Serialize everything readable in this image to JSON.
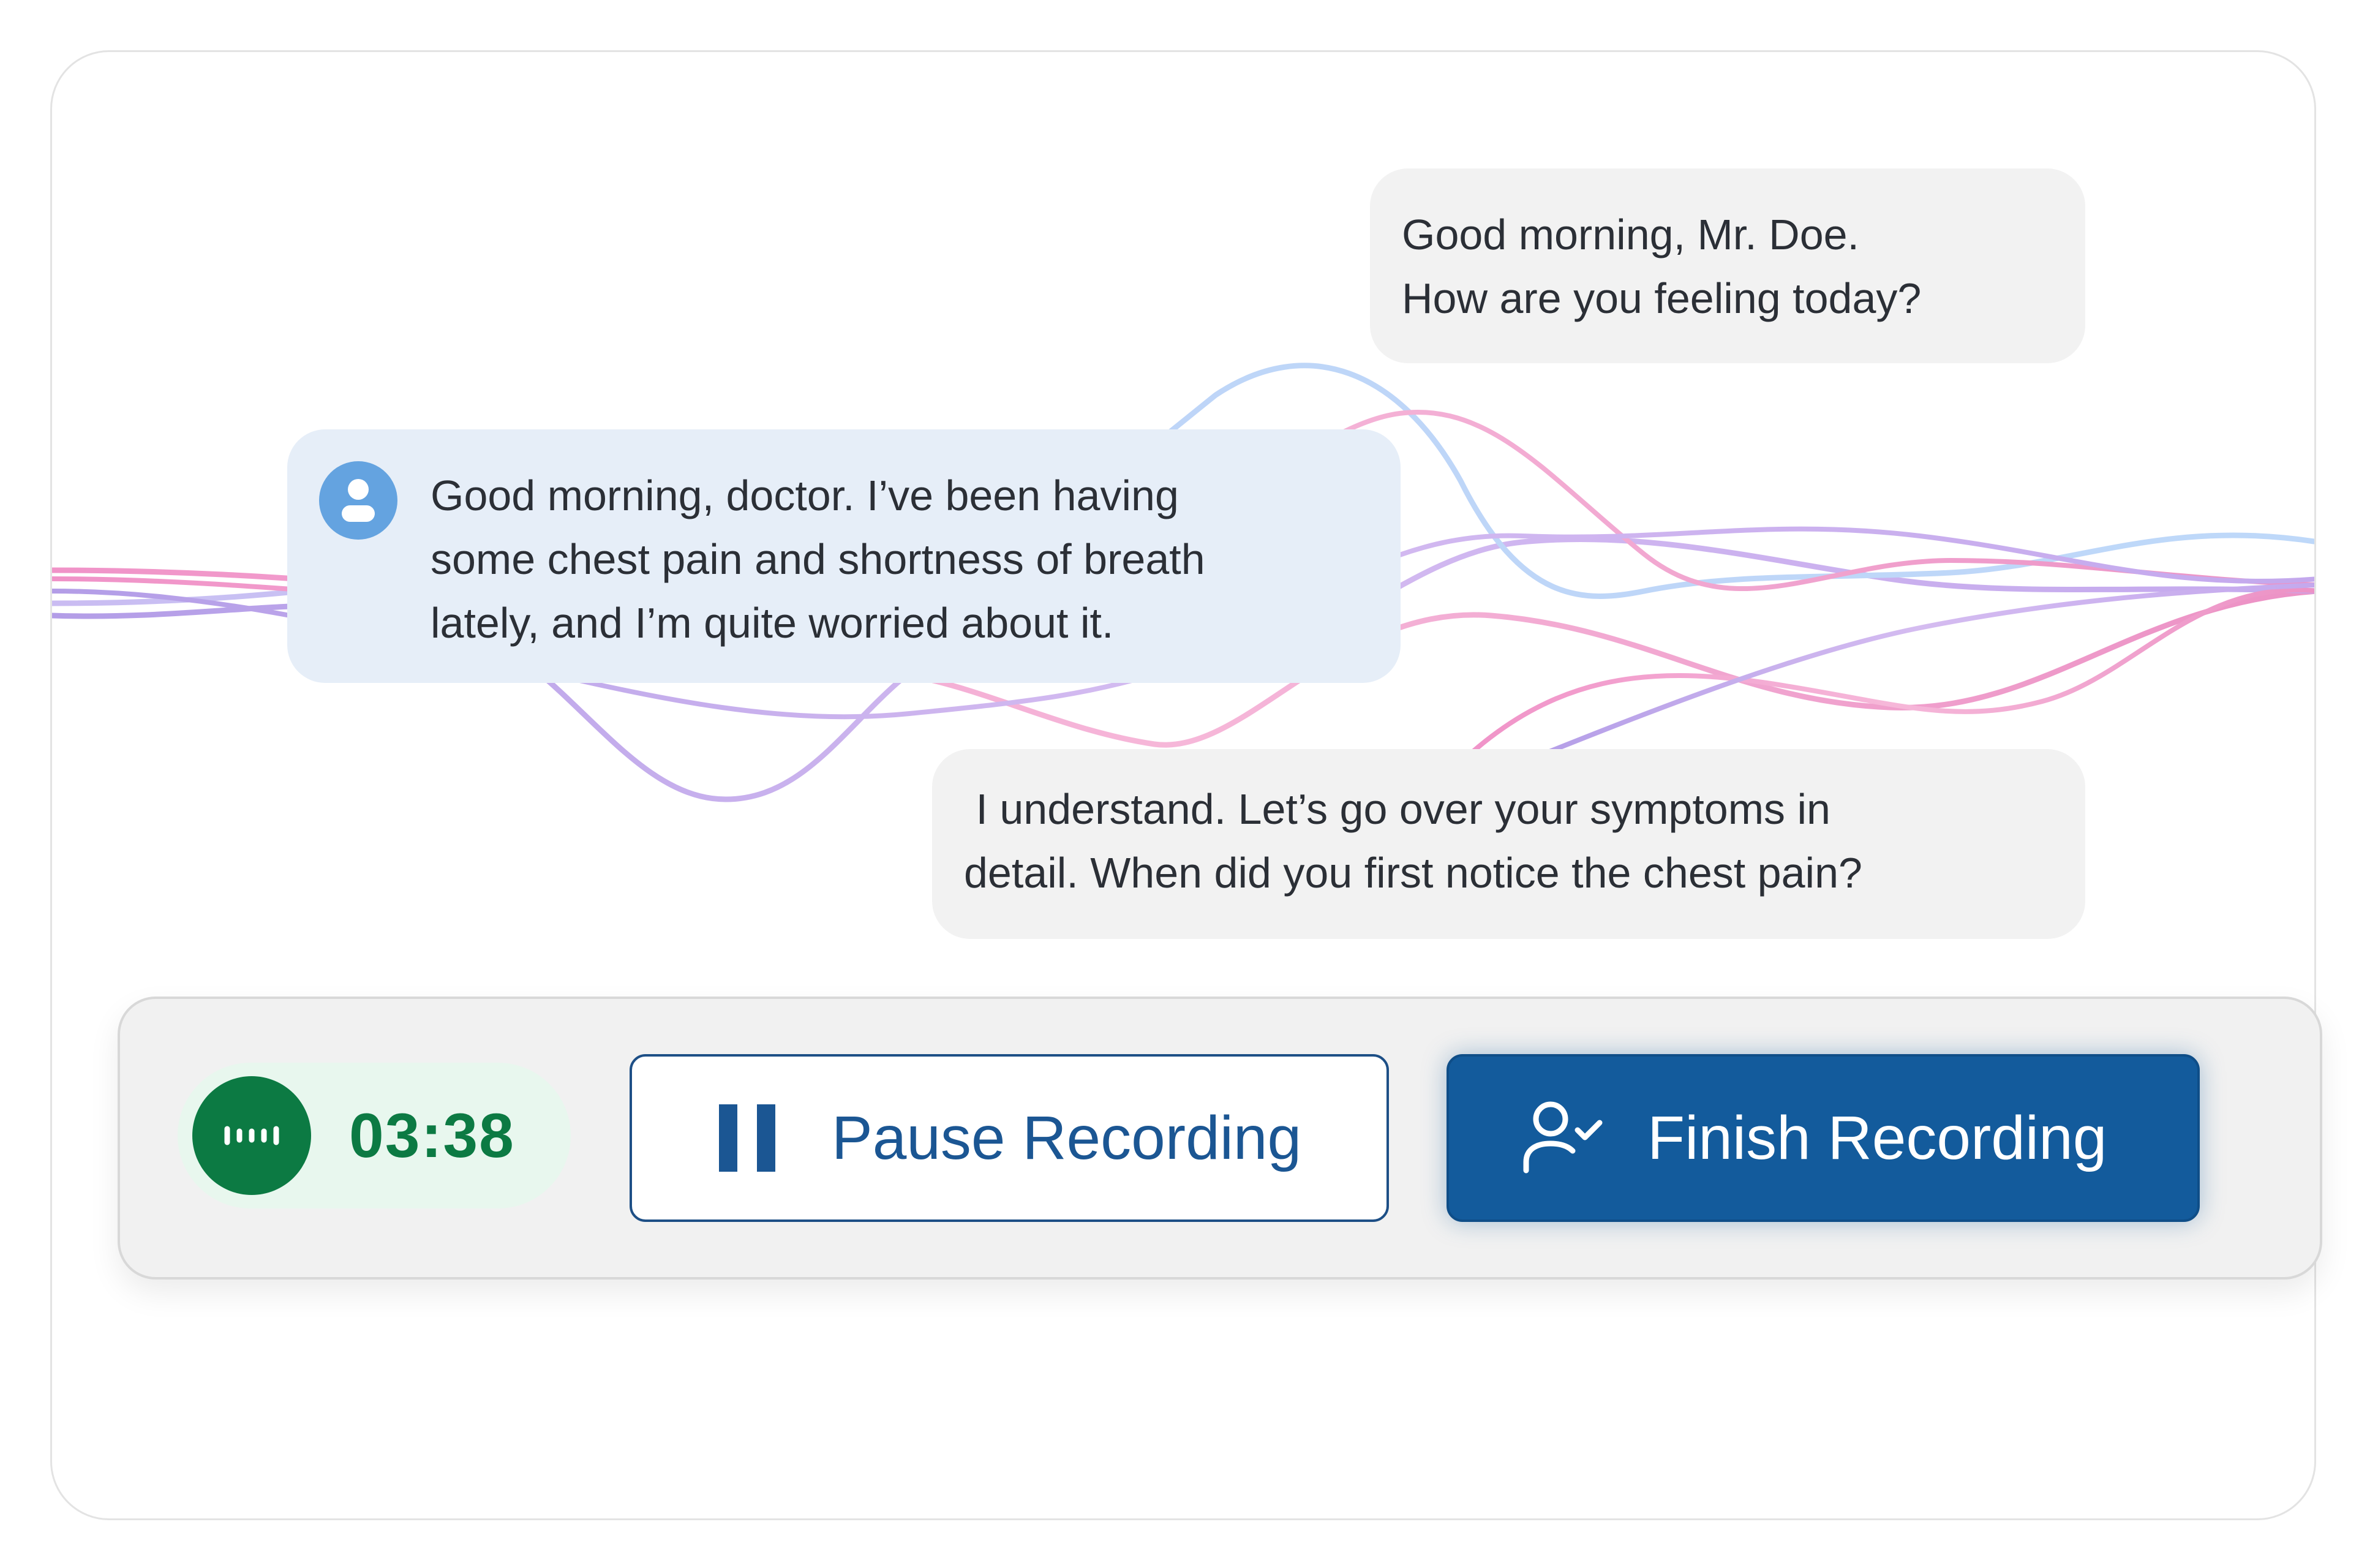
{
  "conversation": {
    "messages": [
      {
        "speaker": "doctor",
        "lines": [
          "Good morning, Mr. Doe.",
          "How are you feeling today?"
        ]
      },
      {
        "speaker": "patient",
        "avatar_icon": "user-icon",
        "lines": [
          "Good morning, doctor. I’ve been having",
          "some chest pain and shortness of breath",
          "lately, and I’m quite worried about it."
        ]
      },
      {
        "speaker": "doctor",
        "lines": [
          " I understand. Let’s go over your symptoms in",
          "detail. When did you first notice the chest pain?"
        ]
      }
    ]
  },
  "recorder": {
    "timer_icon": "audio-wave-icon",
    "elapsed": "03:38",
    "pause_icon": "pause-icon",
    "pause_label": "Pause Recording",
    "finish_icon": "user-check-icon",
    "finish_label": "Finish Recording"
  },
  "colors": {
    "accent_blue": "#135b9c",
    "recording_green": "#0c7a43",
    "patient_bubble": "#e6eef8",
    "doctor_bubble": "#f2f2f2"
  }
}
